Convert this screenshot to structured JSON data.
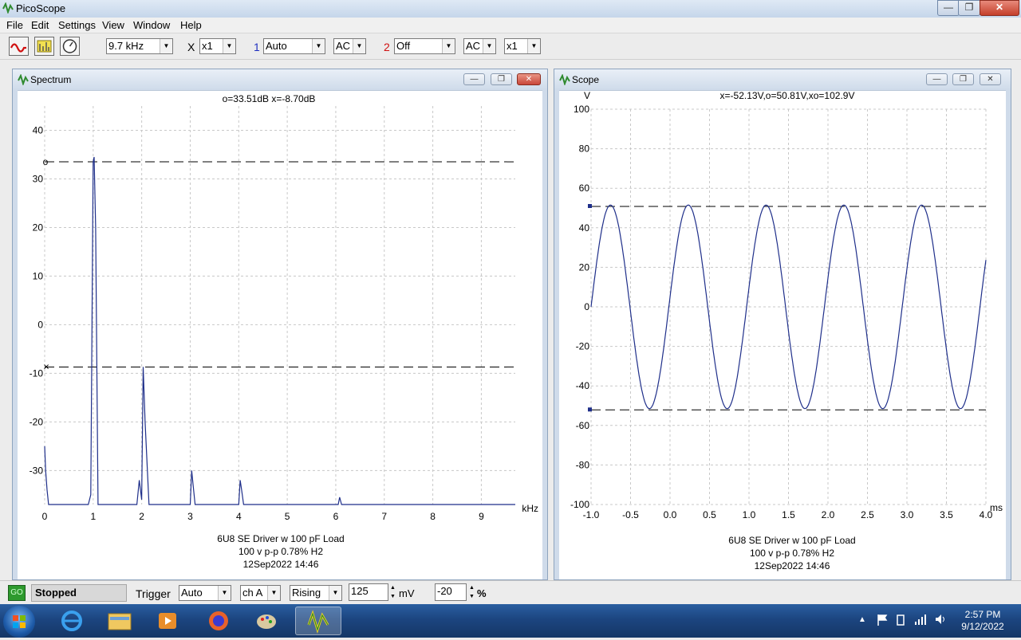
{
  "app": {
    "title": "PicoScope"
  },
  "menu": [
    "File",
    "Edit",
    "Settings",
    "View",
    "Window",
    "Help"
  ],
  "toolbar": {
    "timebase": "9.7 kHz",
    "x_mult_label": "X",
    "x_mult": "x1",
    "ch1_label": "1",
    "ch1_range": "Auto",
    "ch1_coupling": "AC",
    "ch2_label": "2",
    "ch2_range": "Off",
    "ch2_coupling": "AC",
    "y_mult": "x1"
  },
  "spectrum": {
    "title": "Spectrum",
    "readout": "o=33.51dB  x=-8.70dB",
    "x_unit": "kHz",
    "x_ticks": [
      "0",
      "1",
      "2",
      "3",
      "4",
      "5",
      "6",
      "7",
      "8",
      "9"
    ],
    "y_ticks": [
      "40",
      "30",
      "20",
      "10",
      "0",
      "-10",
      "-20",
      "-30"
    ],
    "marker_o": "o",
    "marker_x": "×",
    "caption": [
      "6U8 SE Driver w 100 pF Load",
      "100 v p-p 0.78% H2",
      "12Sep2022  14:46"
    ]
  },
  "scope": {
    "title": "Scope",
    "readout": "x=-52.13V,o=50.81V,xo=102.9V",
    "y_unit": "V",
    "x_unit": "ms",
    "x_ticks": [
      "-1.0",
      "-0.5",
      "0.0",
      "0.5",
      "1.0",
      "1.5",
      "2.0",
      "2.5",
      "3.0",
      "3.5",
      "4.0"
    ],
    "y_ticks": [
      "100",
      "80",
      "60",
      "40",
      "20",
      "0",
      "-20",
      "-40",
      "-60",
      "-80",
      "-100"
    ],
    "caption": [
      "6U8 SE Driver w 100 pF Load",
      "100 v p-p 0.78% H2",
      "12Sep2022  14:46"
    ]
  },
  "chart_data": [
    {
      "type": "line",
      "title": "",
      "xlabel": "kHz",
      "ylabel": "",
      "xlim": [
        0,
        9.7
      ],
      "ylim": [
        -37,
        45
      ],
      "grid": true,
      "cursors": {
        "o": 33.51,
        "x": -8.7
      },
      "series": [
        {
          "x": [
            0,
            0.02,
            0.05,
            0.08,
            0.9,
            0.95,
            1.0,
            1.02,
            1.05,
            1.1,
            1.2,
            1.9,
            1.95,
            2.0,
            2.03,
            2.07,
            2.15,
            3.0,
            3.03,
            3.06,
            3.1,
            4.0,
            4.03,
            4.06,
            4.1,
            6.05,
            6.08,
            6.12,
            9.7
          ],
          "y": [
            -25,
            -30,
            -34,
            -37,
            -37,
            -35,
            33.5,
            34.5,
            20,
            -37,
            -37,
            -37,
            -32,
            -36,
            -8.7,
            -20,
            -37,
            -37,
            -30,
            -33,
            -37,
            -37,
            -32,
            -34,
            -37,
            -37,
            -35.5,
            -37,
            -37
          ]
        }
      ]
    },
    {
      "type": "line",
      "title": "",
      "xlabel": "ms",
      "ylabel": "V",
      "xlim": [
        -1.0,
        4.0
      ],
      "ylim": [
        -100,
        100
      ],
      "grid": true,
      "cursors": {
        "o": 50.81,
        "x": -52.13
      },
      "series": [
        {
          "waveform": "sine",
          "amplitude": 51.5,
          "period_ms": 0.985,
          "phase_zero_ms": -1.0,
          "x_range": [
            -1.0,
            4.0
          ]
        }
      ]
    }
  ],
  "status": {
    "state": "Stopped",
    "trigger_label": "Trigger",
    "trigger_mode": "Auto",
    "trigger_channel": "ch A",
    "trigger_edge": "Rising",
    "trigger_level": "125",
    "trigger_unit": "mV",
    "pretrigger": "-20",
    "pretrigger_unit": "%"
  },
  "taskbar": {
    "time": "2:57 PM",
    "date": "9/12/2022"
  },
  "colors": {
    "trace": "#1f2f8a",
    "ch1": "#2030c0",
    "ch2": "#d01010"
  }
}
